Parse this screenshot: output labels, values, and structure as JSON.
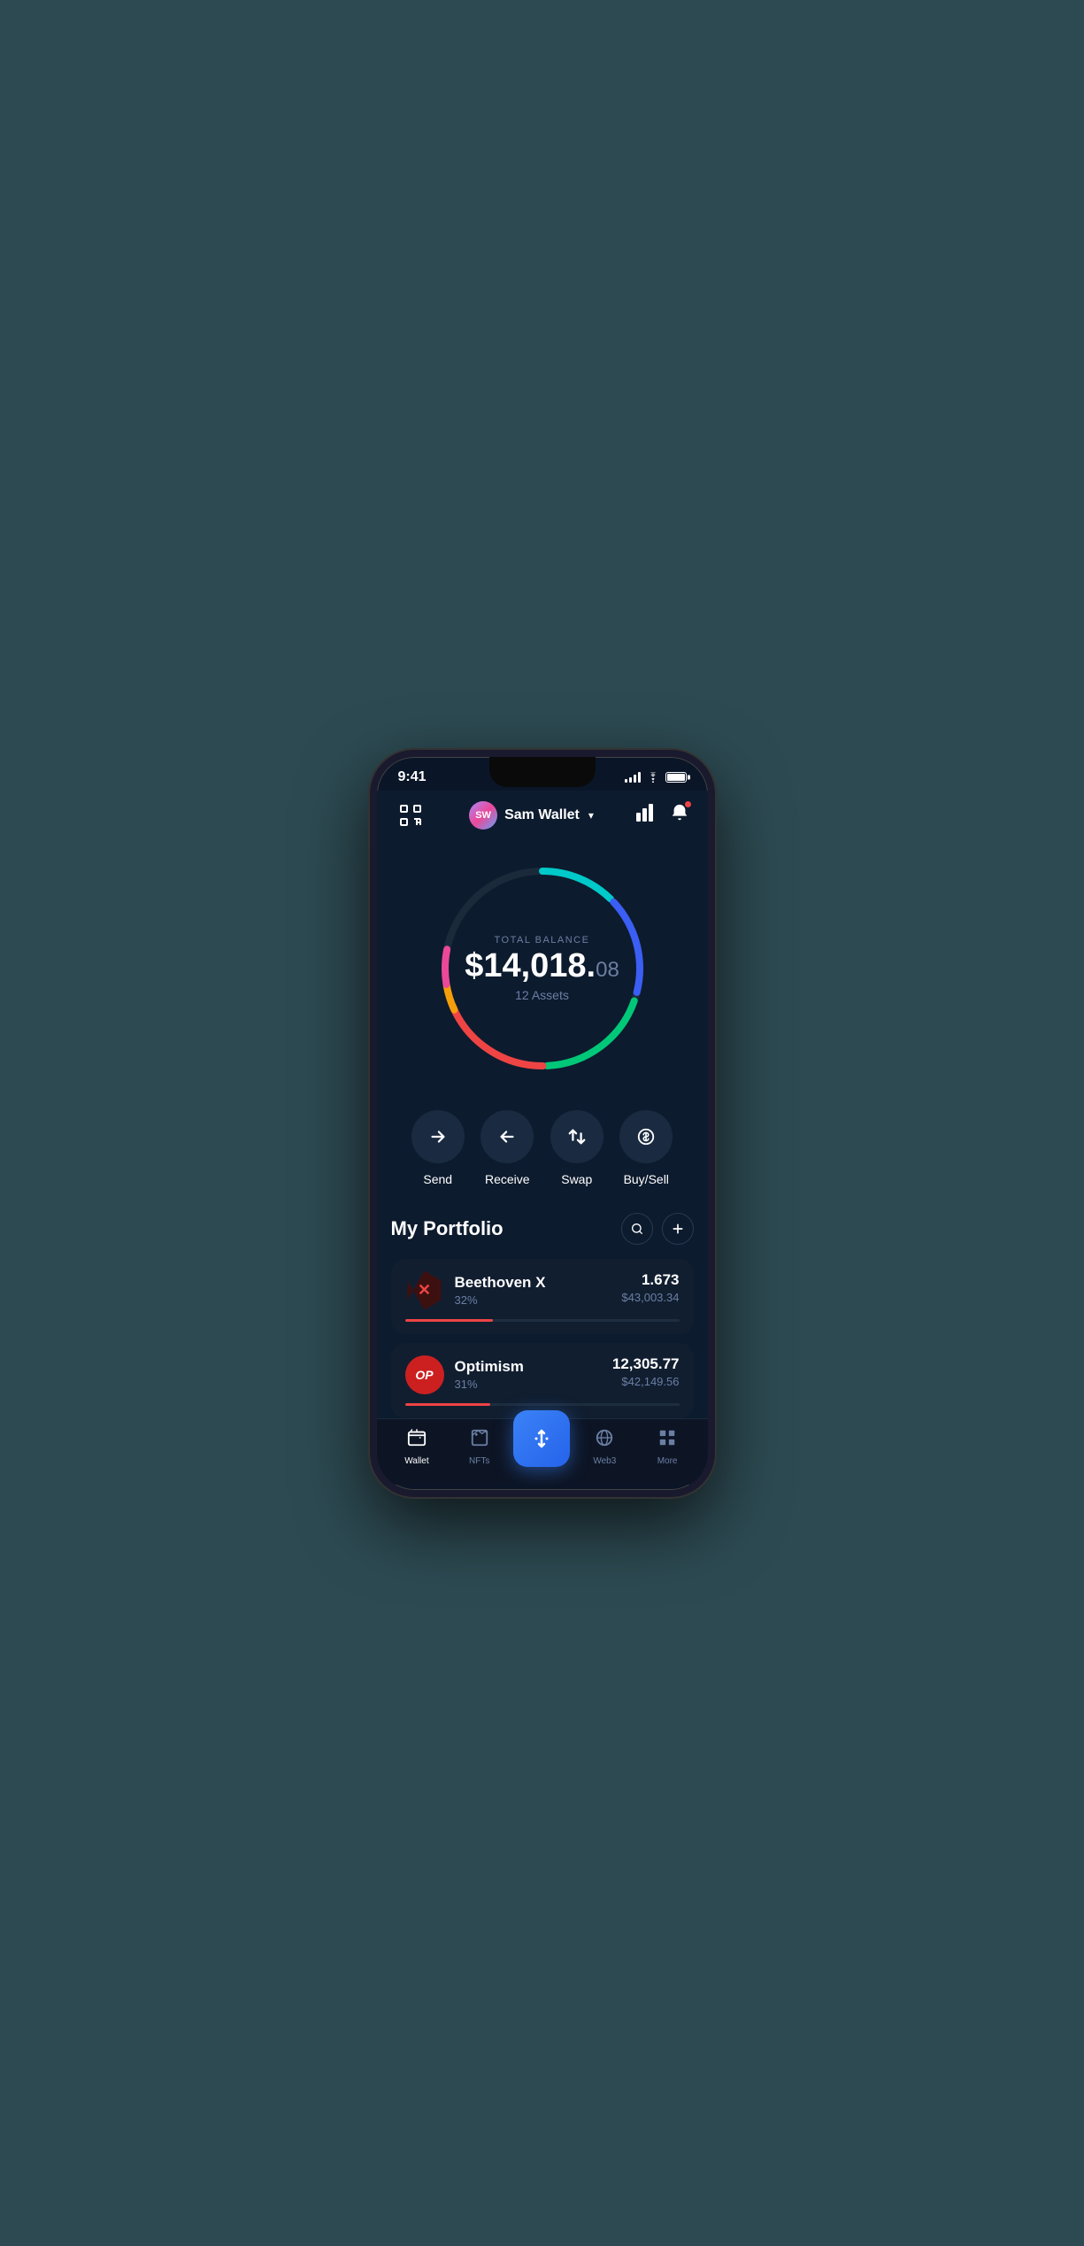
{
  "statusBar": {
    "time": "9:41",
    "batteryFull": true
  },
  "header": {
    "scanLabel": "⊡",
    "walletName": "Sam Wallet",
    "avatarInitials": "SW",
    "chartIcon": "📊",
    "bellIcon": "🔔"
  },
  "portfolio": {
    "totalBalanceLabel": "TOTAL BALANCE",
    "totalBalanceWhole": "$14,018.",
    "totalBalanceCents": "08",
    "assetsLabel": "12 Assets"
  },
  "actions": [
    {
      "id": "send",
      "label": "Send",
      "icon": "→"
    },
    {
      "id": "receive",
      "label": "Receive",
      "icon": "←"
    },
    {
      "id": "swap",
      "label": "Swap",
      "icon": "⇅"
    },
    {
      "id": "buysell",
      "label": "Buy/Sell",
      "icon": "◎"
    }
  ],
  "myPortfolio": {
    "title": "My Portfolio",
    "searchIcon": "🔍",
    "addIcon": "+"
  },
  "portfolioItems": [
    {
      "id": "beethoven-x",
      "name": "Beethoven X",
      "percentage": "32%",
      "amount": "1.673",
      "usdValue": "$43,003.34",
      "progressColor": "#ef4444",
      "progressWidth": 32
    },
    {
      "id": "optimism",
      "name": "Optimism",
      "percentage": "31%",
      "amount": "12,305.77",
      "usdValue": "$42,149.56",
      "progressColor": "#ff5a5a",
      "progressWidth": 31
    }
  ],
  "bottomNav": [
    {
      "id": "wallet",
      "label": "Wallet",
      "active": true
    },
    {
      "id": "nfts",
      "label": "NFTs",
      "active": false
    },
    {
      "id": "center",
      "label": "",
      "isCenter": true
    },
    {
      "id": "web3",
      "label": "Web3",
      "active": false
    },
    {
      "id": "more",
      "label": "More",
      "active": false
    }
  ],
  "colors": {
    "background": "#0d1b2e",
    "cardBackground": "#111e30",
    "accent": "#3b82f6",
    "textPrimary": "#ffffff",
    "textSecondary": "#6b7fa3"
  }
}
